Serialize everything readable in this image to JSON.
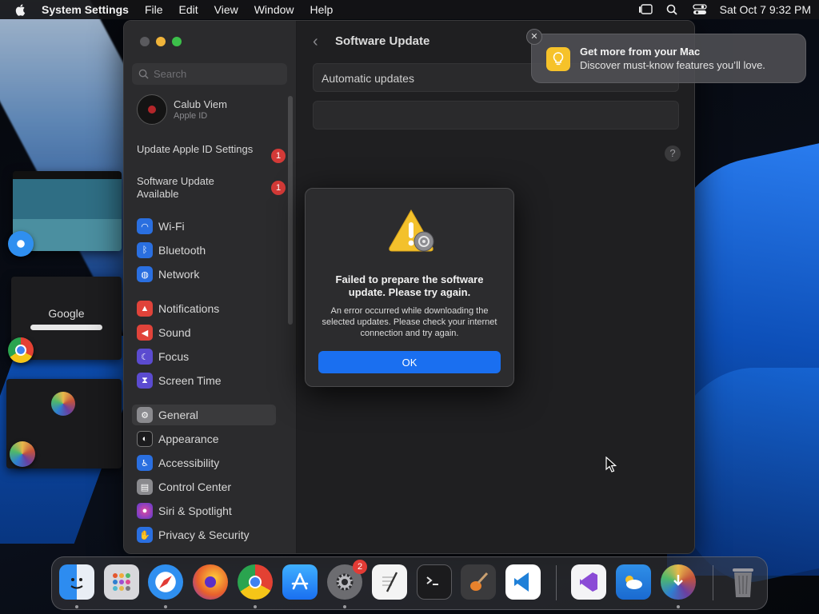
{
  "menubar": {
    "app_name": "System Settings",
    "menus": [
      "File",
      "Edit",
      "View",
      "Window",
      "Help"
    ],
    "clock": "Sat Oct 7  9:32 PM"
  },
  "sidebar": {
    "search_placeholder": "Search",
    "account": {
      "name": "Calub Viem",
      "subtitle": "Apple ID"
    },
    "notices": [
      {
        "label": "Update Apple ID Settings",
        "badge": "1"
      },
      {
        "label": "Software Update Available",
        "badge": "1"
      }
    ],
    "items": [
      {
        "label": "Wi-Fi",
        "icon": "wifi-icon",
        "color": "#2a6fe0"
      },
      {
        "label": "Bluetooth",
        "icon": "bluetooth-icon",
        "color": "#2a6fe0"
      },
      {
        "label": "Network",
        "icon": "globe-icon",
        "color": "#2a6fe0"
      },
      {
        "label": "Notifications",
        "icon": "bell-icon",
        "color": "#e0433a"
      },
      {
        "label": "Sound",
        "icon": "speaker-icon",
        "color": "#e0433a"
      },
      {
        "label": "Focus",
        "icon": "moon-icon",
        "color": "#5b4bd0"
      },
      {
        "label": "Screen Time",
        "icon": "hourglass-icon",
        "color": "#5b4bd0"
      },
      {
        "label": "General",
        "icon": "gear-icon",
        "color": "#8a8a8e"
      },
      {
        "label": "Appearance",
        "icon": "appearance-icon",
        "color": "#1c1c1e"
      },
      {
        "label": "Accessibility",
        "icon": "accessibility-icon",
        "color": "#2a6fe0"
      },
      {
        "label": "Control Center",
        "icon": "control-center-icon",
        "color": "#8a8a8e"
      },
      {
        "label": "Siri & Spotlight",
        "icon": "siri-icon",
        "color": "#c0307e"
      },
      {
        "label": "Privacy & Security",
        "icon": "hand-icon",
        "color": "#2a6fe0"
      }
    ],
    "selected": "General"
  },
  "content": {
    "title": "Software Update",
    "automatic_updates_label": "Automatic updates",
    "help_label": "?"
  },
  "alert": {
    "title": "Failed to prepare the software update. Please try again.",
    "message": "An error occurred while downloading the selected updates. Please check your internet connection and try again.",
    "ok_label": "OK"
  },
  "notification": {
    "title": "Get more from your Mac",
    "body": "Discover must-know features you’ll love.",
    "close_label": "✕"
  },
  "stage_manager": {
    "google_label": "Google"
  },
  "dock": {
    "apps": [
      {
        "name": "finder",
        "color": "#3a8df0",
        "running": true
      },
      {
        "name": "launchpad",
        "color": "#d8d8dc",
        "running": false
      },
      {
        "name": "safari",
        "color": "#2f8ff0",
        "running": true
      },
      {
        "name": "firefox",
        "color": "#e8602c",
        "running": false
      },
      {
        "name": "chrome",
        "color": "#f2f2f2",
        "running": true
      },
      {
        "name": "app-store",
        "color": "#1f8cf5",
        "running": false
      },
      {
        "name": "system-settings",
        "color": "#8c8c90",
        "running": true,
        "badge": "2"
      },
      {
        "name": "textedit",
        "color": "#f4f4f4",
        "running": false
      },
      {
        "name": "terminal",
        "color": "#1b1b1d",
        "running": false
      },
      {
        "name": "garageband",
        "color": "#3b3b3d",
        "running": false
      },
      {
        "name": "vscode",
        "color": "#ffffff",
        "running": false
      },
      {
        "name": "visual-studio",
        "color": "#f4f4f6",
        "running": false
      },
      {
        "name": "weather",
        "color": "#3a8fe8",
        "running": false
      },
      {
        "name": "macos-installer",
        "color": "#7a5bc8",
        "running": true
      },
      {
        "name": "trash",
        "color": "#7b7b80",
        "running": false
      }
    ]
  }
}
